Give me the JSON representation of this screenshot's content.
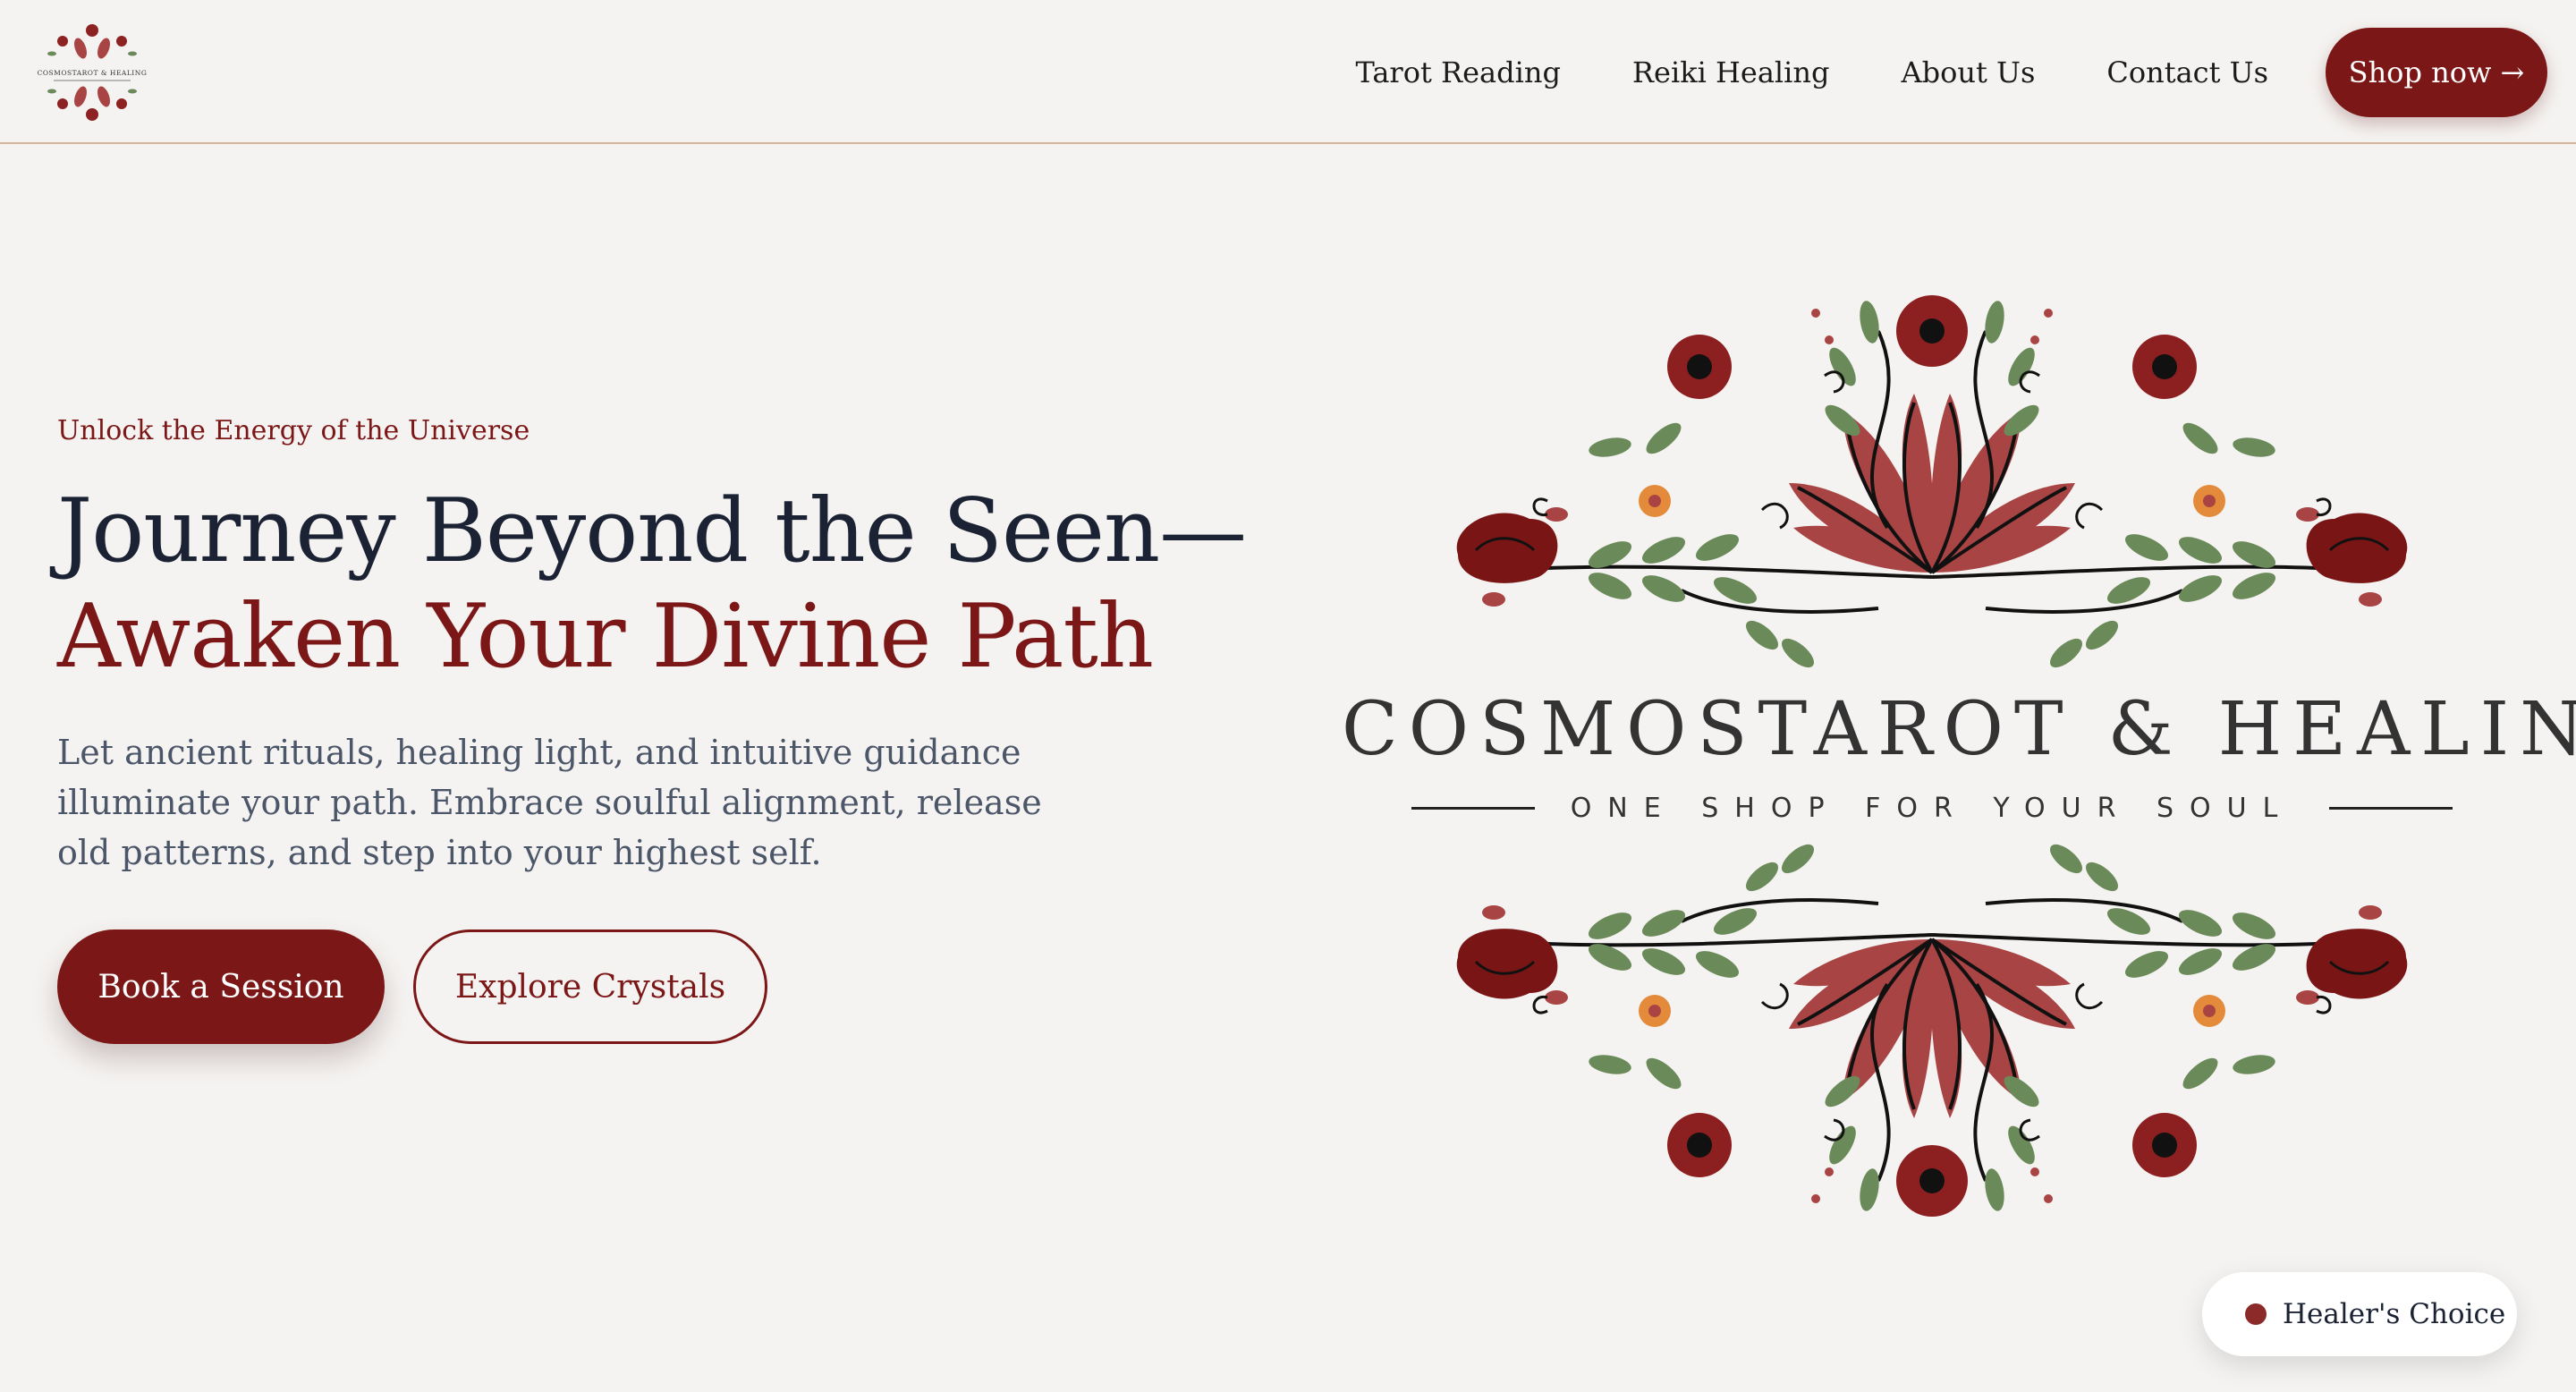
{
  "brand": {
    "logo_text": "COSMOSTAROT & HEALING"
  },
  "nav": {
    "items": [
      {
        "label": "Tarot Reading"
      },
      {
        "label": "Reiki Healing"
      },
      {
        "label": "About Us"
      },
      {
        "label": "Contact Us"
      }
    ],
    "shop_label": "Shop now →"
  },
  "hero": {
    "eyebrow": "Unlock the Energy of the Universe",
    "headline_line1": "Journey Beyond the Seen—",
    "headline_line2": "Awaken Your Divine Path",
    "description": "Let ancient rituals, healing light, and intuitive guidance illuminate your path. Embrace soulful alignment, release old patterns, and step into your highest self.",
    "primary_cta": "Book a Session",
    "secondary_cta": "Explore Crystals"
  },
  "art": {
    "title": "COSMOSTAROT & HEALING",
    "subtitle": "ONE SHOP FOR YOUR SOUL"
  },
  "badge": {
    "label": "Healer's Choice"
  },
  "colors": {
    "accent": "#7b1717",
    "background": "#f5f3f1",
    "headline": "#1a2233",
    "body_text": "#4c5669",
    "petal": "#a94444",
    "leaf": "#6b8a5a",
    "orange": "#e38b3a",
    "divider": "#d7b39b"
  }
}
